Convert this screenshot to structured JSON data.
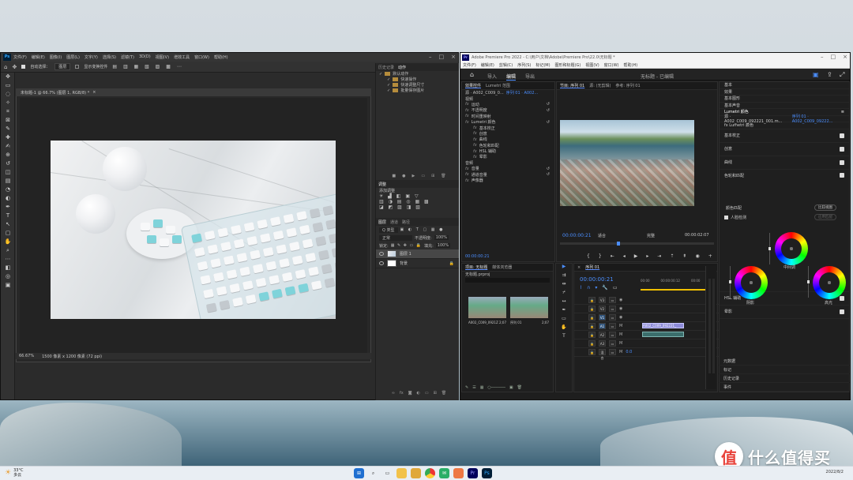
{
  "photoshop": {
    "logo": "Ps",
    "menu": [
      "文件(F)",
      "编辑(E)",
      "图像(I)",
      "图层(L)",
      "文字(Y)",
      "选择(S)",
      "滤镜(T)",
      "3D(D)",
      "视图(V)",
      "增效工具",
      "窗口(W)",
      "帮助(H)"
    ],
    "options": {
      "auto_select": "自动选择：",
      "auto_select_value": "图层",
      "transform": "显示变换控件"
    },
    "doc_tab": "未标题-1 @ 66.7% (图层 1, RGB/8) *",
    "status": {
      "zoom": "66.67%",
      "size": "1500 像素 x 1200 像素 (72 ppi)"
    },
    "panels": {
      "history_tabs": [
        "历史记录",
        "动作"
      ],
      "actions": [
        "默认动作",
        "快速操作",
        "快速调整尺寸",
        "批量保存图片"
      ],
      "adjust_tab": "调整",
      "adjust_label": "添加调整",
      "layer_tabs": [
        "图层",
        "通道",
        "路径"
      ],
      "layer_filter": "Q 类型",
      "blend": "正常",
      "opacity_label": "不透明度:",
      "opacity": "100%",
      "lock_label": "锁定:",
      "fill_label": "填充:",
      "fill": "100%",
      "layers": [
        {
          "name": "图层 1",
          "thumb": "photo"
        },
        {
          "name": "背景",
          "thumb": "white"
        }
      ]
    },
    "tools": [
      "move",
      "artboard",
      "lasso",
      "quick-select",
      "crop",
      "frame",
      "eyedropper",
      "heal",
      "brush",
      "stamp",
      "history-brush",
      "eraser",
      "gradient",
      "blur",
      "dodge",
      "pen",
      "type",
      "path-select",
      "rectangle",
      "hand",
      "zoom",
      "more",
      "fg-bg",
      "quick-mask",
      "screen-mode"
    ]
  },
  "premiere": {
    "logo": "Pr",
    "title": "Adobe Premiere Pro 2022 - C:\\用户\\文档\\Adobe\\Premiere Pro\\22.0\\无标题 *",
    "menu": [
      "文件(F)",
      "编辑(E)",
      "剪辑(C)",
      "序列(S)",
      "标记(M)",
      "图形和标题(G)",
      "视图(V)",
      "窗口(W)",
      "帮助(H)"
    ],
    "workspace_tabs": [
      "导入",
      "编辑",
      "导出"
    ],
    "project_label": "无标题 - 已编辑",
    "effects_panel": {
      "tabs": [
        "效果控件",
        "Lumetri 范围"
      ],
      "source": "源 · A002_C009_0...",
      "sequence": "序列 01 · A002...",
      "rows": [
        "视频",
        "运动",
        "不透明度",
        "时间重映射",
        "Lumetri 颜色",
        "基本校正",
        "创意",
        "曲线",
        "色轮和匹配",
        "HSL 辅助",
        "晕影",
        "音频",
        "音量",
        "通道音量",
        "声像器"
      ],
      "timecode": "00:00:00:21"
    },
    "program": {
      "tabs": [
        "节目: 序列 01",
        "源: (无剪辑)",
        "参考: 序列 01"
      ],
      "timecode": "00:00:00:21",
      "fit": "适合",
      "quality": "完整",
      "duration": "00:00:02:07"
    },
    "project_panel": {
      "tabs": [
        "项目: 无标题",
        "媒体浏览器"
      ],
      "file": "无标题.prproj",
      "clips": [
        {
          "name": "A002_C009_0921ZZ",
          "dur": "2;07"
        },
        {
          "name": "序列 01",
          "dur": "2;07"
        }
      ]
    },
    "timeline": {
      "tab": "序列 01",
      "timecode": "00:00:00:21",
      "ruler": [
        "00:00",
        "00:00:00:12",
        "00:00"
      ],
      "tracks": [
        "V3",
        "V2",
        "V1",
        "A1",
        "A2",
        "A3",
        "混合"
      ],
      "clip_label": "A002_C009_092221_",
      "mix_value": "0.0"
    },
    "lumetri": {
      "sections": [
        "基本",
        "效果",
        "基本图形",
        "基本声音"
      ],
      "panel": "Lumetri 颜色",
      "source": "源 · A002_C009_092221_001.m...",
      "seq": "序列 01 · A002_C009_09222...",
      "effect": "fx Lumetri 颜色",
      "items": [
        "基本校正",
        "创意",
        "曲线",
        "色轮和匹配",
        "HSL 辅助",
        "晕影"
      ],
      "compare": "比较视图",
      "match": "颜色匹配",
      "face": "人脸检测",
      "apply": "应用匹配",
      "wheels": [
        "中间调",
        "阴影",
        "高光"
      ],
      "bottom": [
        "元数据",
        "标记",
        "历史记录",
        "事件"
      ]
    }
  },
  "taskbar": {
    "weather_temp": "33°C",
    "weather_text": "多云",
    "date": "2022/8/2"
  },
  "watermark": "什么值得买",
  "colors": {
    "ps_accent": "#31a8ff",
    "pr_accent": "#9999ff",
    "pr_blue": "#4b8eff",
    "clip_video": "#8d8bd8"
  }
}
